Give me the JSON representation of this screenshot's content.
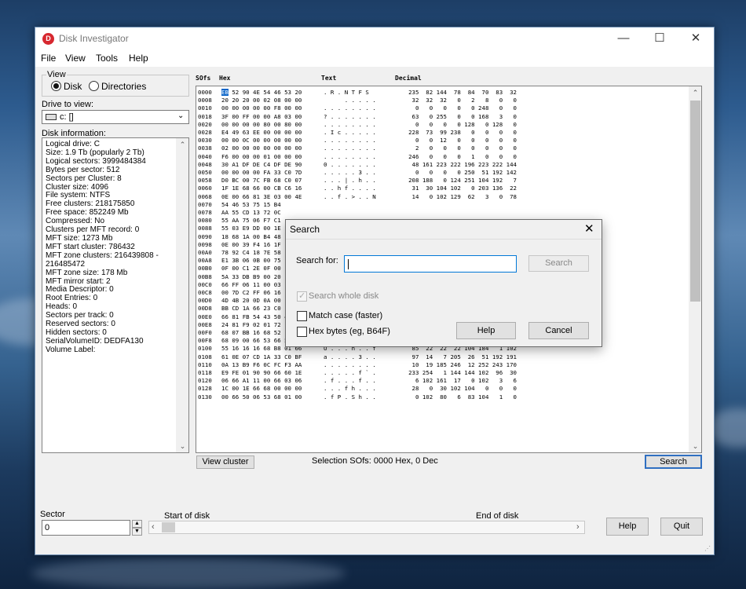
{
  "window": {
    "title": "Disk Investigator",
    "icon_letter": "D",
    "minimize": "—",
    "maximize": "☐",
    "close": "✕"
  },
  "menu": [
    "File",
    "View",
    "Tools",
    "Help"
  ],
  "view": {
    "label": "View",
    "disk": "Disk",
    "directories": "Directories",
    "selected": "Disk"
  },
  "drive": {
    "label": "Drive to view:",
    "value": "c: []"
  },
  "disk_info": {
    "label": "Disk information:",
    "lines": [
      "Logical drive: C",
      "Size: 1.9 Tb (popularly 2 Tb)",
      "Logical sectors: 3999484384",
      "Bytes per sector: 512",
      "Sectors per Cluster: 8",
      "Cluster size: 4096",
      "File system: NTFS",
      "Free clusters: 218175850",
      "Free space: 852249 Mb",
      "Compressed: No",
      "Clusters per MFT record: 0",
      "MFT size: 1273 Mb",
      "MFT start cluster: 786432",
      "MFT zone clusters: 216439808  -",
      "216485472",
      "MFT zone size: 178 Mb",
      "MFT mirror start: 2",
      "Media Descriptor: 0",
      "Root Entries: 0",
      "Heads: 0",
      "Sectors per track: 0",
      "Reserved sectors: 0",
      "Hidden sectors: 0",
      "SerialVolumeID: DEDFA130",
      "Volume Label:"
    ]
  },
  "hex_headers": {
    "sofs": "SOfs",
    "hex": "Hex",
    "text": "Text",
    "decimal": "Decimal"
  },
  "hex_rows": [
    [
      "0000",
      "EB 52 90 4E 54 46 53 20",
      ". R . N T F S",
      "235  82 144  78  84  70  83  32"
    ],
    [
      "0008",
      "20 20 20 00 02 08 00 00",
      "      . . . . .",
      "32  32  32   0   2   8   0   0"
    ],
    [
      "0010",
      "00 00 00 00 00 F8 00 00",
      ". . . . . . . .",
      "0   0   0   0   0 248   0   0"
    ],
    [
      "0018",
      "3F 00 FF 00 00 A8 03 00",
      "? . . . . . . .",
      "63   0 255   0   0 168   3   0"
    ],
    [
      "0020",
      "00 00 00 00 80 00 80 00",
      ". . . . . . . .",
      "0   0   0   0 128   0 128   0"
    ],
    [
      "0028",
      "E4 49 63 EE 00 00 00 00",
      ". I c . . . . .",
      "228  73  99 238   0   0   0   0"
    ],
    [
      "0030",
      "00 00 0C 00 00 00 00 00",
      ". . . . . . . .",
      "0   0  12   0   0   0   0   0"
    ],
    [
      "0038",
      "02 00 00 00 00 00 00 00",
      ". . . . . . . .",
      "2   0   0   0   0   0   0   0"
    ],
    [
      "0040",
      "F6 00 00 00 01 00 00 00",
      ". . . . . . . .",
      "246   0   0   0   1   0   0   0"
    ],
    [
      "0048",
      "30 A1 DF DE C4 DF DE 90",
      "0 . . . . . . .",
      "48 161 223 222 196 223 222 144"
    ],
    [
      "0050",
      "00 00 00 00 FA 33 C0 7D",
      ". . . . . 3 . .",
      "0   0   0   0 250  51 192 142"
    ],
    [
      "0058",
      "D0 BC 00 7C FB 68 C0 07",
      ". . . | . h . .",
      "208 188   0 124 251 104 192   7"
    ],
    [
      "0060",
      "1F 1E 68 66 00 CB C6 16",
      ". . h f . . . .",
      "31  30 104 102   0 203 136  22"
    ],
    [
      "0068",
      "0E 00 66 81 3E 03 00 4E",
      ". . f . > . . N",
      "14   0 102 129  62   3   0  78"
    ],
    [
      "0070",
      "54 46 53 75 15 B4",
      "",
      ""
    ],
    [
      "0078",
      "AA 55 CD 13 72 0C",
      "",
      ""
    ],
    [
      "0080",
      "55 AA 75 06 F7 C1",
      "",
      ""
    ],
    [
      "0088",
      "55 03 E9 DD 00 1E",
      "",
      ""
    ],
    [
      "0090",
      "18 68 1A 00 B4 48",
      "",
      ""
    ],
    [
      "0098",
      "0E 00 39 F4 16 1F",
      "",
      ""
    ],
    [
      "00A0",
      "78 92 C4 18 7E 58",
      "",
      ""
    ],
    [
      "00A8",
      "E1 3B 06 0B 00 75",
      "",
      ""
    ],
    [
      "00B0",
      "0F 00 C1 2E 0F 00",
      "",
      ""
    ],
    [
      "00B8",
      "5A 33 DB B9 00 20",
      "",
      ""
    ],
    [
      "00C0",
      "66 FF 06 11 00 03",
      "",
      ""
    ],
    [
      "00C8",
      "00 7D C2 FF 06 16",
      "",
      ""
    ],
    [
      "00D0",
      "4D 4B 20 0D 0A 00",
      "",
      ""
    ],
    [
      "00D8",
      "BB CD 1A 66 23 C0",
      "",
      ""
    ],
    [
      "00E0",
      "66 81 FB 54 43 50 41 75",
      "f . . T C P A u",
      "102 129 251  84  67  80  65 117"
    ],
    [
      "00E8",
      "24 81 F9 02 01 72 1E 16",
      "$ . . . . r . .",
      "36 129 249   2   1 114  30  22"
    ],
    [
      "00F0",
      "68 07 BB 16 68 52 11 16",
      "h . . . h R . .",
      "104   7 187  22 104  82  17  22"
    ],
    [
      "00F8",
      "68 09 00 66 53 66 53 66",
      "h . . f S f S f",
      "104   9   0 102  83 102  83 102"
    ],
    [
      "0100",
      "55 16 16 16 68 B8 01 66",
      "U . . . h . . f",
      "85  22  22  22 104 184   1 102"
    ],
    [
      "0108",
      "61 0E 07 CD 1A 33 C0 BF",
      "a . . . . 3 . .",
      "97  14   7 205  26  51 192 191"
    ],
    [
      "0110",
      "0A 13 B9 F6 0C FC F3 AA",
      ". . . . . . . .",
      "10  19 185 246  12 252 243 170"
    ],
    [
      "0118",
      "E9 FE 01 90 90 66 60 1E",
      ". . . . . f ` .",
      "233 254   1 144 144 102  96  30"
    ],
    [
      "0120",
      "06 66 A1 11 00 66 03 06",
      ". f . . . f . .",
      "6 102 161  17   0 102   3   6"
    ],
    [
      "0128",
      "1C 00 1E 66 68 00 00 00",
      ". . . f h . . .",
      "28   0  30 102 104   0   0   0"
    ],
    [
      "0130",
      "00 66 50 06 53 68 01 00",
      ". f P . S h . .",
      "0 102  80   6  83 104   1   0"
    ]
  ],
  "buttons": {
    "view_cluster": "View cluster",
    "search": "Search",
    "help": "Help",
    "quit": "Quit"
  },
  "selection_status": "Selection SOfs: 0000 Hex,  0 Dec",
  "sector": {
    "label": "Sector",
    "value": "0",
    "start": "Start of disk",
    "end": "End of disk"
  },
  "dialog": {
    "title": "Search",
    "close": "✕",
    "search_for_label": "Search for:",
    "search_value": "",
    "search_button": "Search",
    "search_whole_disk": "Search whole disk",
    "match_case": "Match case (faster)",
    "hex_bytes": "Hex bytes (eg, B64F)",
    "help": "Help",
    "cancel": "Cancel"
  }
}
